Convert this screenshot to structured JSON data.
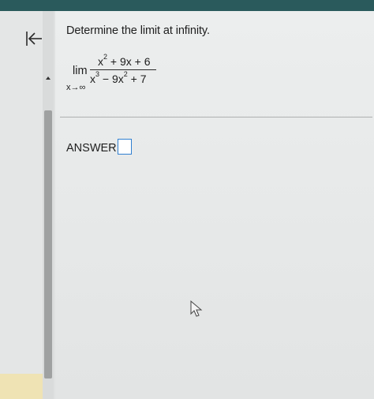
{
  "question": {
    "prompt": "Determine the limit at infinity.",
    "lim_word": "lim",
    "lim_sub": "x→∞",
    "numerator": [
      {
        "t": "x"
      },
      {
        "sup": "2"
      },
      {
        "t": " + 9x + 6"
      }
    ],
    "denominator": [
      {
        "t": "x"
      },
      {
        "sup": "3"
      },
      {
        "t": " − 9x"
      },
      {
        "sup": "2"
      },
      {
        "t": " + 7"
      }
    ]
  },
  "answer": {
    "label": "ANSWER:",
    "value": ""
  },
  "icons": {
    "collapse": "collapse-left-icon",
    "scroll_up": "triangle-up-icon",
    "pointer": "mouse-pointer-icon"
  },
  "colors": {
    "topbar": "#2a5a5c",
    "answer_border": "#2f7fd0",
    "scroll_thumb": "#9fa1a1"
  }
}
